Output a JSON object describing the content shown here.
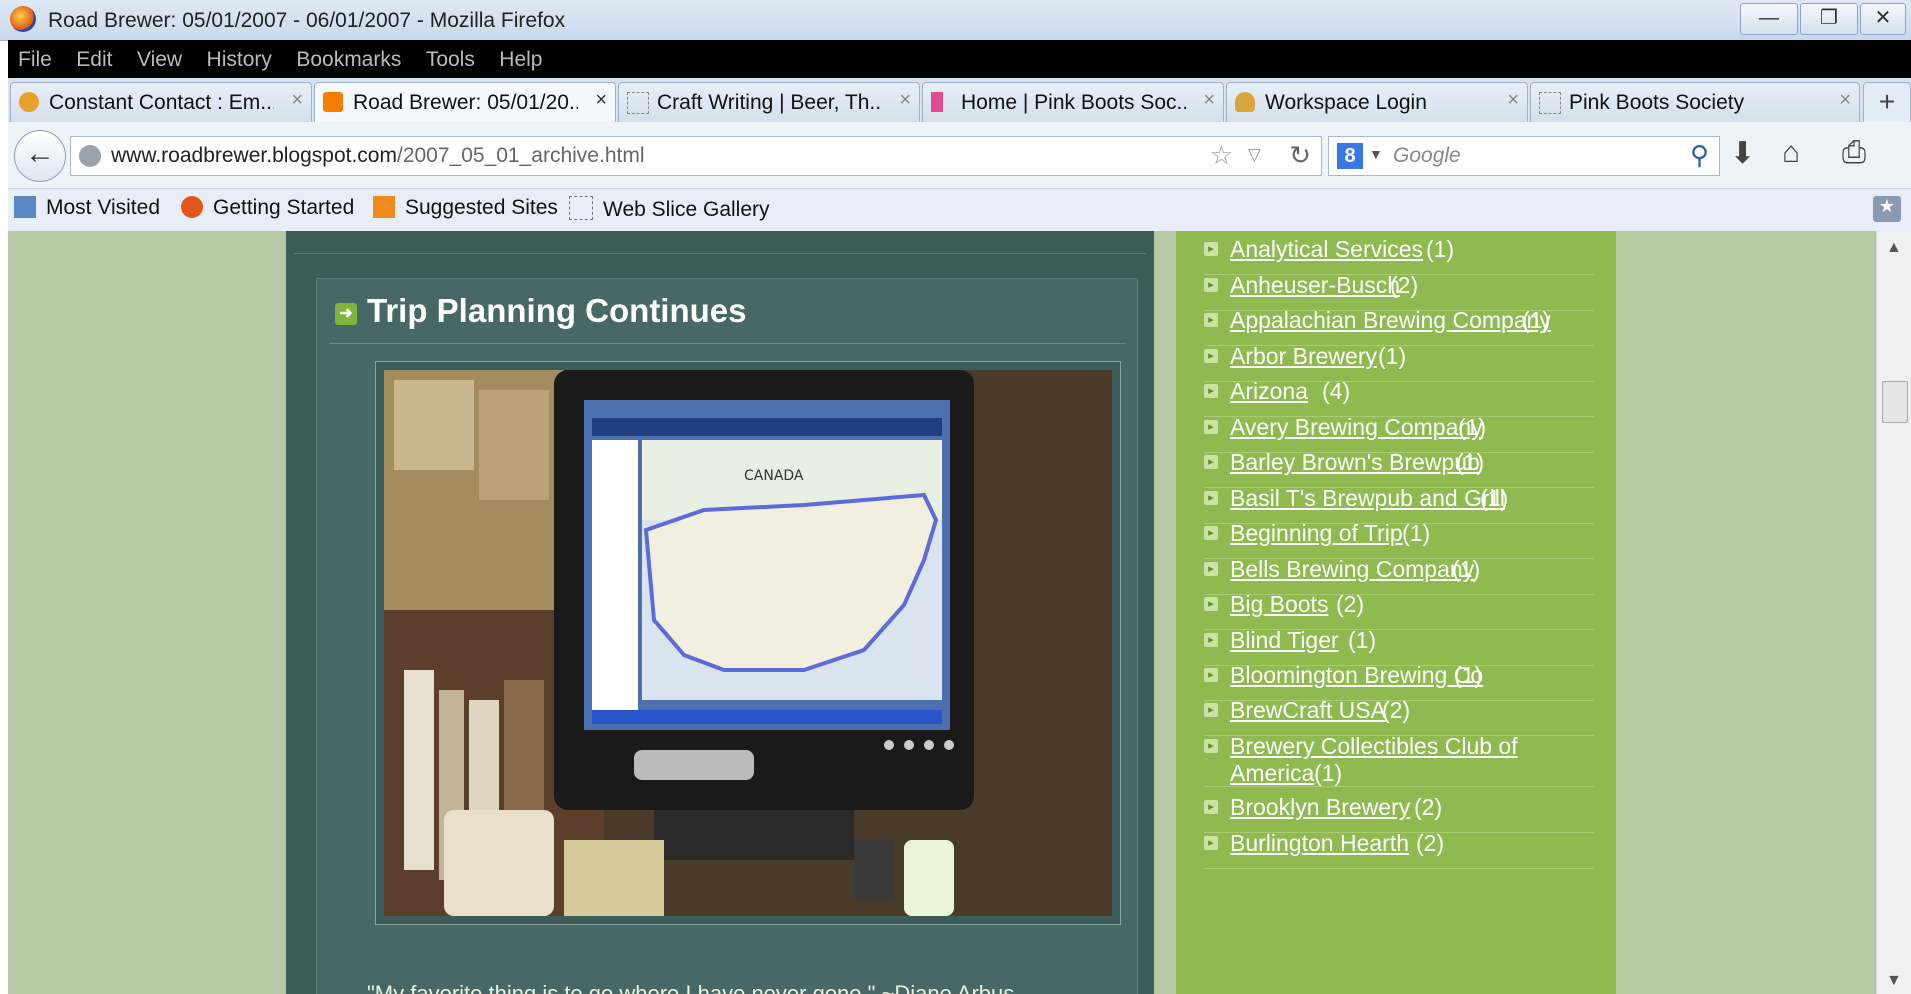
{
  "window": {
    "title": "Road Brewer: 05/01/2007 - 06/01/2007 - Mozilla Firefox",
    "minimize": "—",
    "restore": "❐",
    "close": "✕"
  },
  "menu": [
    "File",
    "Edit",
    "View",
    "History",
    "Bookmarks",
    "Tools",
    "Help"
  ],
  "tabs": [
    {
      "label": "Constant Contact : Em...",
      "icon": "constant-contact-icon"
    },
    {
      "label": "Road Brewer: 05/01/20...",
      "icon": "blogger-icon",
      "active": true
    },
    {
      "label": "Craft Writing | Beer, Th...",
      "icon": "page-icon"
    },
    {
      "label": "Home | Pink Boots Soc...",
      "icon": "pink-boot-icon"
    },
    {
      "label": "Workspace Login",
      "icon": "workspace-icon"
    },
    {
      "label": "Pink Boots Society",
      "icon": "page-icon"
    }
  ],
  "tab_close": "×",
  "new_tab": "+",
  "nav": {
    "back": "←",
    "url_domain": "www.roadbrewer.blogspot.com",
    "url_path": "/2007_05_01_archive.html",
    "search_placeholder": "Google",
    "search_engine": "8"
  },
  "bookmarks": [
    "Most Visited",
    "Getting Started",
    "Suggested Sites",
    "Web Slice Gallery"
  ],
  "post": {
    "title": "Trip Planning Continues",
    "quote": "\"My favorite thing is to go where I have never gone.\" ~Diane Arbus",
    "image_caption": "CANADA"
  },
  "labels": [
    {
      "name": "Analytical Services",
      "count": "(1)"
    },
    {
      "name": "Anheuser-Busch",
      "count": "(2)"
    },
    {
      "name": "Appalachian Brewing Company",
      "count": "(1)"
    },
    {
      "name": "Arbor Brewery",
      "count": "(1)"
    },
    {
      "name": "Arizona",
      "count": "(4)"
    },
    {
      "name": "Avery Brewing Company",
      "count": "(1)"
    },
    {
      "name": "Barley Brown's Brewpub",
      "count": "(1)"
    },
    {
      "name": "Basil T's Brewpub and Grill",
      "count": "(1)"
    },
    {
      "name": "Beginning of Trip",
      "count": "(1)"
    },
    {
      "name": "Bells Brewing Company",
      "count": "(1)"
    },
    {
      "name": "Big Boots",
      "count": "(2)"
    },
    {
      "name": "Blind Tiger",
      "count": "(1)"
    },
    {
      "name": "Bloomington Brewing Co",
      "count": "(1)"
    },
    {
      "name": "BrewCraft USA",
      "count": "(2)"
    },
    {
      "name": "Brewery Collectibles Club of",
      "name2": "America",
      "count": "(1)"
    },
    {
      "name": "Brooklyn Brewery",
      "count": "(2)"
    },
    {
      "name": "Burlington Hearth",
      "count": "(2)"
    }
  ],
  "colors": {
    "page_bg": "#b7caa3",
    "main_panel": "#3c5c5a",
    "sidebar": "#8fba4f",
    "menubar": "#000000"
  }
}
